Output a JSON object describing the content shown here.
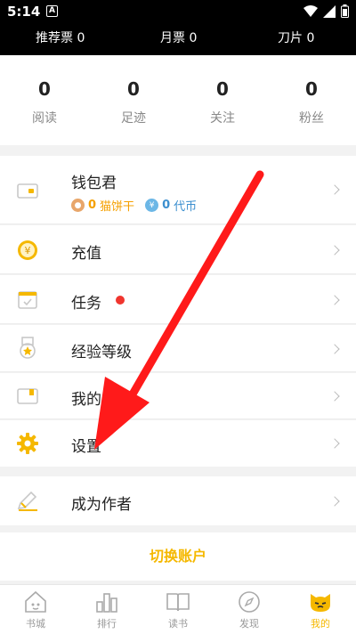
{
  "status_bar": {
    "time": "5:14",
    "a_badge": "A"
  },
  "tickets": [
    {
      "label": "推荐票 0"
    },
    {
      "label": "月票 0"
    },
    {
      "label": "刀片 0"
    }
  ],
  "stats": [
    {
      "value": "0",
      "label": "阅读"
    },
    {
      "value": "0",
      "label": "足迹"
    },
    {
      "value": "0",
      "label": "关注"
    },
    {
      "value": "0",
      "label": "粉丝"
    }
  ],
  "menu": {
    "wallet": {
      "label": "钱包君",
      "catcake_value": "0",
      "catcake_label": "猫饼干",
      "coin_value": "0",
      "coin_label": "代币",
      "coin_symbol": "¥"
    },
    "recharge": {
      "label": "充值",
      "icon_symbol": "¥"
    },
    "tasks": {
      "label": "任务"
    },
    "level": {
      "label": "经验等级"
    },
    "cards": {
      "label": "我的卡包"
    },
    "settings": {
      "label": "设置"
    },
    "author": {
      "label": "成为作者"
    }
  },
  "switch_account": {
    "label": "切换账户"
  },
  "tabs": [
    {
      "label": "书城",
      "icon": "house-icon"
    },
    {
      "label": "排行",
      "icon": "ranking-icon"
    },
    {
      "label": "读书",
      "icon": "book-icon"
    },
    {
      "label": "发现",
      "icon": "compass-icon"
    },
    {
      "label": "我的",
      "icon": "cat-face-icon"
    }
  ],
  "colors": {
    "accent": "#f5b800",
    "red_dot": "#f0352e",
    "annotation_arrow": "#ff1a1a"
  }
}
